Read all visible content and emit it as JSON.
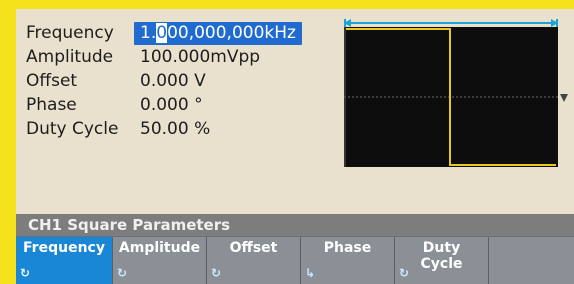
{
  "params": {
    "frequency": {
      "label": "Frequency",
      "pre": "1.",
      "cursor": "0",
      "post": "00,000,000kHz"
    },
    "amplitude": {
      "label": "Amplitude",
      "value": "100.000mVpp"
    },
    "offset": {
      "label": "Offset",
      "value": "0.000 V"
    },
    "phase": {
      "label": "Phase",
      "value": "0.000 °"
    },
    "duty": {
      "label": "Duty Cycle",
      "value": "50.00 %"
    }
  },
  "section_title": "CH1 Square Parameters",
  "softkeys": [
    {
      "label": "Frequency",
      "active": true,
      "icon": "knob-icon"
    },
    {
      "label": "Amplitude",
      "active": false,
      "icon": "knob-icon"
    },
    {
      "label": "Offset",
      "active": false,
      "icon": "knob-icon"
    },
    {
      "label": "Phase",
      "active": false,
      "icon": "phase-icon"
    },
    {
      "label": "Duty Cycle",
      "active": false,
      "icon": "knob-icon"
    }
  ],
  "colors": {
    "frame": "#0a66e6",
    "accent_yellow": "#f5e21a",
    "waveform": "#e8c81a",
    "selected": "#1f6bd0",
    "softkey_active": "#1a86d6"
  }
}
